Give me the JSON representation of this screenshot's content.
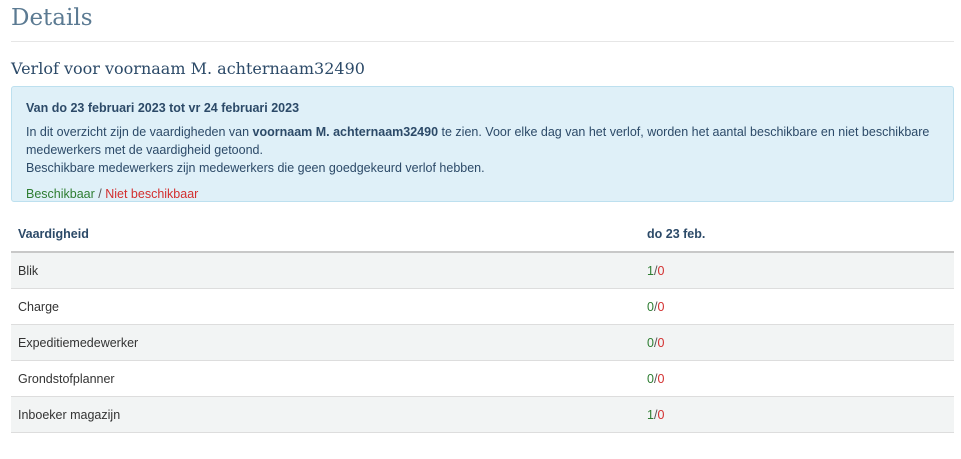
{
  "page": {
    "title": "Details",
    "subtitle": "Verlof voor voornaam M. achternaam32490"
  },
  "info": {
    "range": "Van do 23 februari 2023 tot vr 24 februari 2023",
    "line1_pre": "In dit overzicht zijn de vaardigheden van ",
    "line1_name": "voornaam M. achternaam32490",
    "line1_post": " te zien. Voor elke dag van het verlof, worden het aantal beschikbare en niet beschikbare medewerkers met de vaardigheid getoond.",
    "line2": "Beschikbare medewerkers zijn medewerkers die geen goedgekeurd verlof hebben.",
    "legend_available": "Beschikbaar",
    "legend_separator": " / ",
    "legend_unavailable": "Niet beschikbaar"
  },
  "table": {
    "header_skill": "Vaardigheid",
    "header_date": "do 23 feb.",
    "separator": "/",
    "rows": [
      {
        "skill": "Blik",
        "available": "1",
        "unavailable": "0"
      },
      {
        "skill": "Charge",
        "available": "0",
        "unavailable": "0"
      },
      {
        "skill": "Expeditiemedewerker",
        "available": "0",
        "unavailable": "0"
      },
      {
        "skill": "Grondstofplanner",
        "available": "0",
        "unavailable": "0"
      },
      {
        "skill": "Inboeker magazijn",
        "available": "1",
        "unavailable": "0"
      }
    ]
  },
  "colors": {
    "available": "#2e7d32",
    "unavailable": "#d32f2f",
    "info_background": "#dff0f8",
    "title": "#5b7a92"
  }
}
